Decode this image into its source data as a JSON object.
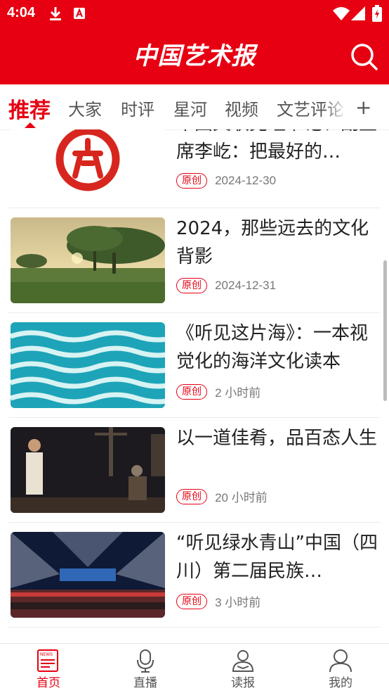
{
  "status_bar": {
    "time": "4:04"
  },
  "app_bar": {
    "logo_text": "中国艺术报"
  },
  "tabs": [
    {
      "label": "推荐"
    },
    {
      "label": "大家"
    },
    {
      "label": "时评"
    },
    {
      "label": "星河"
    },
    {
      "label": "视频"
    },
    {
      "label": "文艺评论"
    }
  ],
  "tab_add_label": "+",
  "articles": [
    {
      "title": "中国文联党组书记、副主席李屹：把最好的…",
      "tag": "原创",
      "date": "2024-12-30"
    },
    {
      "title": "2024，那些远去的文化背影",
      "tag": "原创",
      "date": "2024-12-31"
    },
    {
      "title": "《听见这片海》：一本视觉化的海洋文化读本",
      "tag": "原创",
      "date": "2 小时前"
    },
    {
      "title": "以一道佳肴，品百态人生",
      "tag": "原创",
      "date": "20 小时前"
    },
    {
      "title": "“听见绿水青山”中国（四川）第二届民族…",
      "tag": "原创",
      "date": "3 小时前"
    }
  ],
  "bottom_nav": [
    {
      "label": "首页",
      "icon": "news-icon"
    },
    {
      "label": "直播",
      "icon": "microphone-icon"
    },
    {
      "label": "读报",
      "icon": "reader-icon"
    },
    {
      "label": "我的",
      "icon": "user-icon"
    }
  ],
  "colors": {
    "brand": "#e60012"
  }
}
